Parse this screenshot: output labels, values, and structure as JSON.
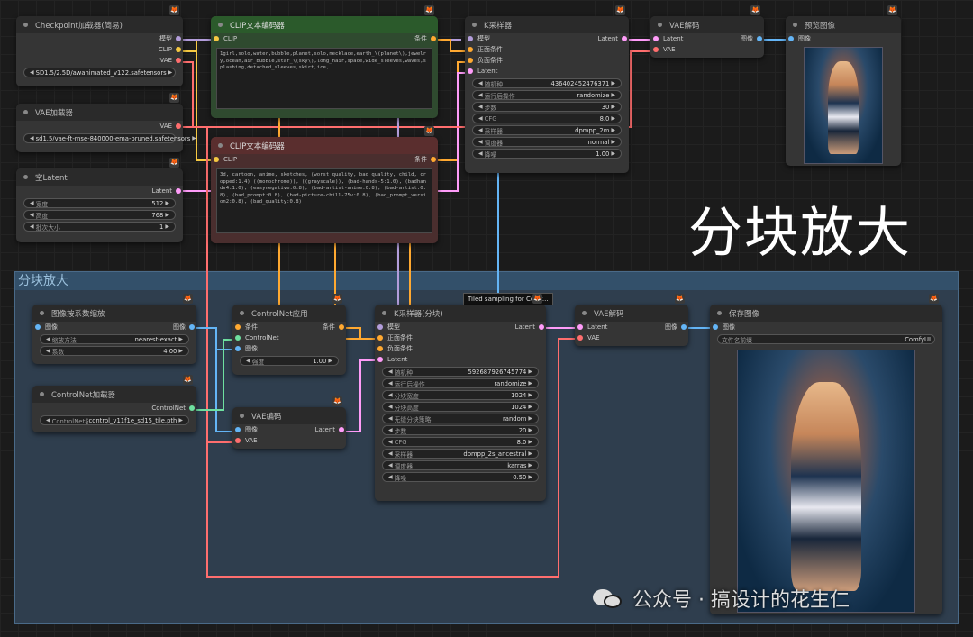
{
  "canvas": {
    "big_label": "分块放大",
    "group_title": "分块放大",
    "tooltip": "Tiled sampling for Comf..."
  },
  "watermark": {
    "text": "公众号 · 搞设计的花生仁"
  },
  "nodes": {
    "ckpt": {
      "title": "Checkpoint加载器(简易)",
      "outputs": [
        "模型",
        "CLIP",
        "VAE"
      ],
      "ckpt_name": "SD1.5/2.5D/awanimated_v122.safetensors"
    },
    "vae_loader": {
      "title": "VAE加载器",
      "output": "VAE",
      "vae_name": "sd1.5/vae-ft-mse-840000-ema-pruned.safetensors"
    },
    "empty_latent": {
      "title": "空Latent",
      "output": "Latent",
      "width_label": "宽度",
      "width": "512",
      "height_label": "高度",
      "height": "768",
      "batch_label": "批次大小",
      "batch": "1"
    },
    "clip_pos": {
      "title": "CLIP文本编码器",
      "input": "CLIP",
      "output": "条件",
      "text": "1girl,solo,water,bubble,planet,solo,necklace,earth_\\(planet\\),jewelry,ocean,air_bubble,star_\\(sky\\),long_hair,space,wide_sleeves,waves,splashing,detached_sleeves,skirt,ice,"
    },
    "clip_neg": {
      "title": "CLIP文本编码器",
      "input": "CLIP",
      "output": "条件",
      "text": "3d, cartoon, anime, sketches, (worst quality, bad quality, child, cropped:1.4) ((monochrome)), ((grayscale)), (bad-hands-5:1.0), (badhandv4:1.0), (easynegative:0.8), (bad-artist-anime:0.8), (bad-artist:0.8), (bad_prompt:0.8), (bad-picture-chill-75v:0.8), (bad_prompt_version2:0.8), (bad_quality:0.8)"
    },
    "ksampler": {
      "title": "K采样器",
      "inputs": [
        "模型",
        "正面条件",
        "负面条件",
        "Latent"
      ],
      "output": "Latent",
      "widgets": [
        [
          "随机种",
          "436402452476371"
        ],
        [
          "运行后操作",
          "randomize"
        ],
        [
          "步数",
          "30"
        ],
        [
          "CFG",
          "8.0"
        ],
        [
          "采样器",
          "dpmpp_2m"
        ],
        [
          "调度器",
          "normal"
        ],
        [
          "降噪",
          "1.00"
        ]
      ]
    },
    "vae_decode_top": {
      "title": "VAE解码",
      "inputs": [
        "Latent",
        "VAE"
      ],
      "output": "图像"
    },
    "preview": {
      "title": "预览图像",
      "input": "图像"
    },
    "upscale": {
      "title": "图像按系数缩放",
      "input": "图像",
      "output": "图像",
      "w": [
        [
          "缩放方法",
          "nearest-exact"
        ],
        [
          "系数",
          "4.00"
        ]
      ]
    },
    "controlnet_loader": {
      "title": "ControlNet加载器",
      "output": "ControlNet",
      "w": [
        [
          "ControlNet名称",
          "control_v11f1e_sd15_tile.pth"
        ]
      ]
    },
    "controlnet_apply": {
      "title": "ControlNet应用",
      "inputs": [
        "条件",
        "ControlNet",
        "图像"
      ],
      "output": "条件",
      "w": [
        [
          "强度",
          "1.00"
        ]
      ]
    },
    "vae_encode": {
      "title": "VAE编码",
      "inputs": [
        "图像",
        "VAE"
      ],
      "output": "Latent"
    },
    "ksampler_tiled": {
      "title": "K采样器(分块)",
      "inputs": [
        "模型",
        "正面条件",
        "负面条件",
        "Latent"
      ],
      "output": "Latent",
      "widgets": [
        [
          "随机种",
          "592687926745774"
        ],
        [
          "运行后操作",
          "randomize"
        ],
        [
          "分块宽度",
          "1024"
        ],
        [
          "分块高度",
          "1024"
        ],
        [
          "无缝分块策略",
          "random"
        ],
        [
          "步数",
          "20"
        ],
        [
          "CFG",
          "8.0"
        ],
        [
          "采样器",
          "dpmpp_2s_ancestral"
        ],
        [
          "调度器",
          "karras"
        ],
        [
          "降噪",
          "0.50"
        ]
      ]
    },
    "vae_decode_bot": {
      "title": "VAE解码",
      "inputs": [
        "Latent",
        "VAE"
      ],
      "output": "图像"
    },
    "save": {
      "title": "保存图像",
      "input": "图像",
      "prefix_label": "文件名前缀",
      "prefix": "ComfyUI"
    }
  },
  "colors": {
    "model": "#b39ddb",
    "clip": "#f5c842",
    "vae": "#ff6e6e",
    "cond": "#ffa931",
    "latent": "#ff9cf9",
    "image": "#64b5f6",
    "controlnet": "#6ee0a0"
  }
}
